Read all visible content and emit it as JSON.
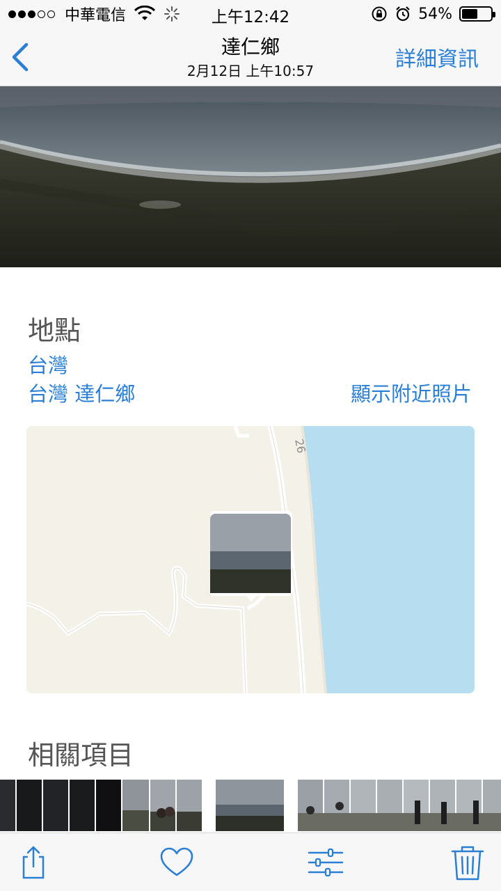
{
  "status_bar": {
    "carrier": "中華電信",
    "time": "上午12:42",
    "battery_text": "54%",
    "battery_level": 0.54
  },
  "nav": {
    "title": "達仁鄉",
    "subtitle": "2月12日  上午10:57",
    "right_label": "詳細資訊",
    "back_icon": "chevron-left-icon"
  },
  "location": {
    "heading": "地點",
    "country": "台灣",
    "place": "台灣 達仁鄉",
    "nearby_link": "顯示附近照片",
    "road_label": "26"
  },
  "related": {
    "heading": "相關項目"
  },
  "toolbar": {
    "icons": [
      "share-icon",
      "heart-icon",
      "adjust-icon",
      "trash-icon"
    ]
  },
  "colors": {
    "accent": "#2a7fd5",
    "sea": "#b6ddf0",
    "land": "#f4f1e8"
  }
}
